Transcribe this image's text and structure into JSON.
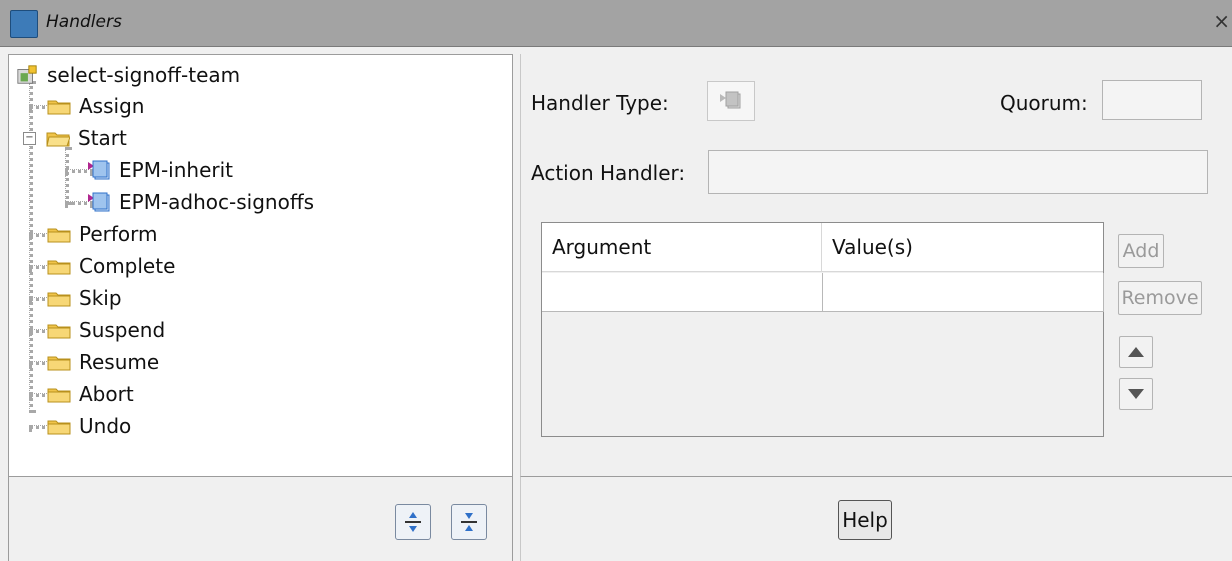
{
  "window": {
    "title": "Handlers",
    "close_label": "×"
  },
  "tree": {
    "root": "select-signoff-team",
    "items": [
      {
        "label": "Assign"
      },
      {
        "label": "Start"
      },
      {
        "label": "EPM-inherit"
      },
      {
        "label": "EPM-adhoc-signoffs"
      },
      {
        "label": "Perform"
      },
      {
        "label": "Complete"
      },
      {
        "label": "Skip"
      },
      {
        "label": "Suspend"
      },
      {
        "label": "Resume"
      },
      {
        "label": "Abort"
      },
      {
        "label": "Undo"
      }
    ]
  },
  "form": {
    "handler_type_label": "Handler Type:",
    "quorum_label": "Quorum:",
    "quorum_value": "",
    "action_handler_label": "Action Handler:",
    "action_handler_value": ""
  },
  "table": {
    "headers": [
      "Argument",
      "Value(s)"
    ],
    "rows": [
      [
        "",
        ""
      ]
    ]
  },
  "buttons": {
    "add": "Add",
    "remove": "Remove",
    "help": "Help"
  },
  "icons": {
    "app": "handlers-app-icon",
    "folder": "folder-icon",
    "handler": "handler-icon",
    "root": "task-root-icon",
    "collapse": "collapse-icon",
    "move_up": "arrow-up-icon",
    "move_down": "arrow-down-icon",
    "expand_all": "expand-all-icon",
    "collapse_all": "collapse-all-icon"
  },
  "colors": {
    "titlebar": "#a3a3a3",
    "folder": "#f0c44a",
    "handler_blue": "#2f70c8"
  }
}
